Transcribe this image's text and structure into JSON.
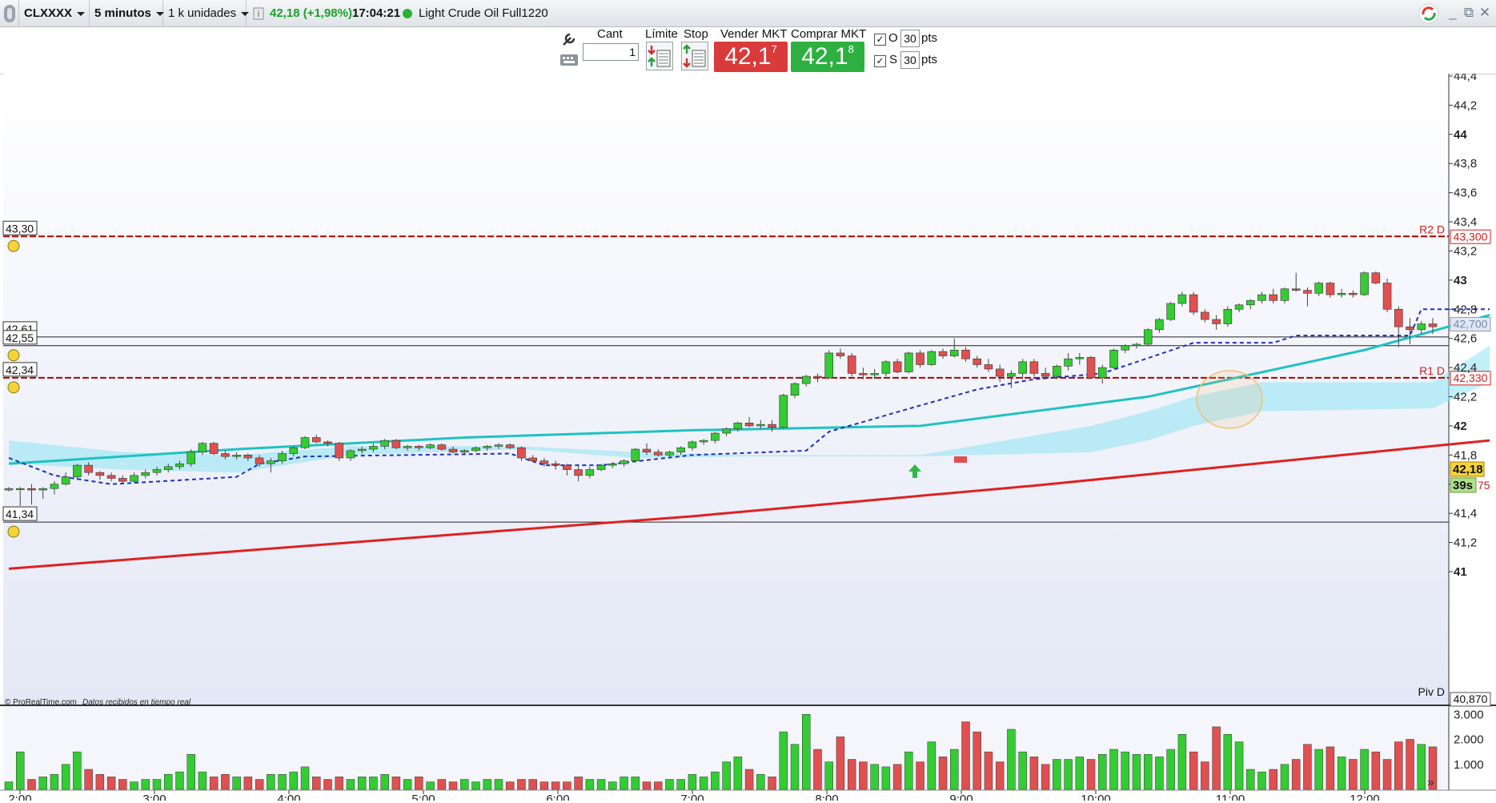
{
  "header": {
    "symbol": "CLXXXX",
    "timeframe": "5 minutos",
    "units": "1 k unidades",
    "info_icon": "info-icon",
    "price_change": "42,18 (+1,98%)",
    "time": "17:04:21",
    "instrument": "Light Crude Oil Full1220"
  },
  "toolbar": {
    "qty_label": "Cant",
    "qty_value": "1",
    "limit_label": "Límite",
    "stop_label": "Stop",
    "sell_label": "Vender MKT",
    "sell_price_main": "42,1",
    "sell_price_sup": "7",
    "buy_label": "Comprar MKT",
    "buy_price_main": "42,1",
    "buy_price_sup": "8",
    "o_label": "O",
    "o_value": "30",
    "s_label": "S",
    "s_value": "30",
    "pts_label": "pts"
  },
  "colors": {
    "up": "#33cc33",
    "down": "#e05050",
    "ema_teal": "#1fc2c2",
    "sma_red": "#e02020",
    "stop_blue": "#1f2fbf",
    "cloud": "#8ee4f2",
    "pivot": "#b00000"
  },
  "footer": {
    "copyright": "© ProRealTime.com",
    "realtime": "Datos recibidos en tiempo real"
  },
  "chart_data": {
    "type": "candlestick",
    "ylim": [
      40.87,
      44.45
    ],
    "y_ticks": [
      "44,4",
      "44,2",
      "44",
      "43,8",
      "43,6",
      "43,4",
      "43,2",
      "43",
      "42,8",
      "42,6",
      "42,4",
      "42,2",
      "42",
      "41,8",
      "41,6",
      "41,4",
      "41,2",
      "41"
    ],
    "x_ticks": [
      "2:00",
      "3:00",
      "4:00",
      "5:00",
      "6:00",
      "7:00",
      "8:00",
      "9:00",
      "10:00",
      "11:00",
      "12:00"
    ],
    "levels": [
      {
        "name": "R2 D",
        "value": 43.3,
        "left_label": "43,30",
        "right_label": "43,300"
      },
      {
        "name": "R1 D",
        "value": 42.33,
        "left_label": "42,34",
        "right_label": "42,330"
      },
      {
        "name": "Piv D",
        "value": 40.87,
        "right_label": "40,870"
      }
    ],
    "hlines": [
      {
        "value": 42.61,
        "left_label": "42,61"
      },
      {
        "value": 42.55,
        "left_label": "42,55"
      },
      {
        "value": 41.34,
        "left_label": "41,34"
      }
    ],
    "right_tags": [
      {
        "label": "42,700"
      },
      {
        "label": "42,18"
      },
      {
        "label": "39s"
      },
      {
        "label": "75"
      }
    ],
    "candles": [
      [
        41.56,
        41.58,
        41.55,
        41.57
      ],
      [
        41.57,
        41.58,
        41.45,
        41.57
      ],
      [
        41.57,
        41.6,
        41.46,
        41.56
      ],
      [
        41.56,
        41.58,
        41.5,
        41.57
      ],
      [
        41.57,
        41.62,
        41.53,
        41.6
      ],
      [
        41.6,
        41.68,
        41.59,
        41.65
      ],
      [
        41.65,
        41.74,
        41.63,
        41.73
      ],
      [
        41.73,
        41.75,
        41.66,
        41.68
      ],
      [
        41.68,
        41.69,
        41.63,
        41.66
      ],
      [
        41.66,
        41.68,
        41.62,
        41.64
      ],
      [
        41.64,
        41.66,
        41.6,
        41.62
      ],
      [
        41.62,
        41.68,
        41.61,
        41.66
      ],
      [
        41.66,
        41.7,
        41.64,
        41.68
      ],
      [
        41.68,
        41.72,
        41.66,
        41.7
      ],
      [
        41.7,
        41.74,
        41.68,
        41.72
      ],
      [
        41.72,
        41.76,
        41.7,
        41.74
      ],
      [
        41.74,
        41.84,
        41.72,
        41.82
      ],
      [
        41.82,
        41.89,
        41.8,
        41.88
      ],
      [
        41.88,
        41.89,
        41.8,
        41.81
      ],
      [
        41.81,
        41.83,
        41.77,
        41.79
      ],
      [
        41.79,
        41.82,
        41.77,
        41.8
      ],
      [
        41.8,
        41.81,
        41.76,
        41.78
      ],
      [
        41.78,
        41.8,
        41.72,
        41.74
      ],
      [
        41.74,
        41.78,
        41.68,
        41.76
      ],
      [
        41.76,
        41.83,
        41.74,
        41.81
      ],
      [
        41.81,
        41.86,
        41.79,
        41.85
      ],
      [
        41.85,
        41.93,
        41.84,
        41.92
      ],
      [
        41.92,
        41.94,
        41.88,
        41.89
      ],
      [
        41.89,
        41.9,
        41.86,
        41.88
      ],
      [
        41.88,
        41.89,
        41.76,
        41.78
      ],
      [
        41.78,
        41.84,
        41.76,
        41.83
      ],
      [
        41.83,
        41.86,
        41.81,
        41.84
      ],
      [
        41.84,
        41.88,
        41.82,
        41.86
      ],
      [
        41.86,
        41.91,
        41.84,
        41.9
      ],
      [
        41.9,
        41.91,
        41.84,
        41.85
      ],
      [
        41.85,
        41.87,
        41.83,
        41.86
      ],
      [
        41.86,
        41.87,
        41.83,
        41.85
      ],
      [
        41.85,
        41.88,
        41.84,
        41.87
      ],
      [
        41.87,
        41.88,
        41.83,
        41.84
      ],
      [
        41.84,
        41.86,
        41.81,
        41.82
      ],
      [
        41.82,
        41.84,
        41.8,
        41.83
      ],
      [
        41.83,
        41.86,
        41.82,
        41.85
      ],
      [
        41.85,
        41.87,
        41.83,
        41.86
      ],
      [
        41.86,
        41.88,
        41.84,
        41.87
      ],
      [
        41.87,
        41.88,
        41.84,
        41.85
      ],
      [
        41.85,
        41.86,
        41.76,
        41.78
      ],
      [
        41.78,
        41.8,
        41.75,
        41.76
      ],
      [
        41.76,
        41.78,
        41.72,
        41.74
      ],
      [
        41.74,
        41.76,
        41.7,
        41.73
      ],
      [
        41.73,
        41.74,
        41.66,
        41.7
      ],
      [
        41.7,
        41.74,
        41.62,
        41.66
      ],
      [
        41.66,
        41.72,
        41.64,
        41.7
      ],
      [
        41.7,
        41.74,
        41.69,
        41.73
      ],
      [
        41.73,
        41.75,
        41.71,
        41.74
      ],
      [
        41.74,
        41.77,
        41.72,
        41.76
      ],
      [
        41.76,
        41.85,
        41.75,
        41.84
      ],
      [
        41.84,
        41.88,
        41.8,
        41.82
      ],
      [
        41.82,
        41.84,
        41.79,
        41.8
      ],
      [
        41.8,
        41.83,
        41.78,
        41.82
      ],
      [
        41.82,
        41.86,
        41.8,
        41.85
      ],
      [
        41.85,
        41.9,
        41.83,
        41.89
      ],
      [
        41.89,
        41.91,
        41.87,
        41.9
      ],
      [
        41.9,
        41.96,
        41.88,
        41.95
      ],
      [
        41.95,
        41.99,
        41.93,
        41.98
      ],
      [
        41.98,
        42.03,
        41.96,
        42.02
      ],
      [
        42.02,
        42.06,
        41.99,
        42.0
      ],
      [
        42.0,
        42.04,
        41.98,
        42.01
      ],
      [
        42.01,
        42.04,
        41.96,
        41.99
      ],
      [
        41.99,
        42.22,
        41.98,
        42.21
      ],
      [
        42.21,
        42.3,
        42.19,
        42.29
      ],
      [
        42.29,
        42.35,
        42.27,
        42.34
      ],
      [
        42.34,
        42.36,
        42.3,
        42.33
      ],
      [
        42.33,
        42.52,
        42.32,
        42.5
      ],
      [
        42.5,
        42.53,
        42.46,
        42.48
      ],
      [
        42.48,
        42.5,
        42.34,
        42.36
      ],
      [
        42.36,
        42.4,
        42.32,
        42.35
      ],
      [
        42.35,
        42.39,
        42.32,
        42.36
      ],
      [
        42.36,
        42.45,
        42.34,
        42.44
      ],
      [
        42.44,
        42.46,
        42.36,
        42.37
      ],
      [
        42.37,
        42.51,
        42.36,
        42.5
      ],
      [
        42.5,
        42.52,
        42.4,
        42.42
      ],
      [
        42.42,
        42.52,
        42.41,
        42.51
      ],
      [
        42.51,
        42.53,
        42.46,
        42.48
      ],
      [
        42.48,
        42.6,
        42.47,
        42.52
      ],
      [
        42.52,
        42.54,
        42.44,
        42.46
      ],
      [
        42.46,
        42.48,
        42.4,
        42.42
      ],
      [
        42.42,
        42.46,
        42.37,
        42.39
      ],
      [
        42.39,
        42.42,
        42.3,
        42.34
      ],
      [
        42.34,
        42.38,
        42.26,
        42.36
      ],
      [
        42.36,
        42.46,
        42.32,
        42.44
      ],
      [
        42.44,
        42.46,
        42.34,
        42.36
      ],
      [
        42.36,
        42.4,
        42.32,
        42.34
      ],
      [
        42.34,
        42.42,
        42.32,
        42.41
      ],
      [
        42.41,
        42.5,
        42.38,
        42.46
      ],
      [
        42.46,
        42.5,
        42.42,
        42.47
      ],
      [
        42.47,
        42.48,
        42.32,
        42.33
      ],
      [
        42.33,
        42.42,
        42.29,
        42.4
      ],
      [
        42.4,
        42.53,
        42.39,
        42.52
      ],
      [
        42.52,
        42.56,
        42.5,
        42.55
      ],
      [
        42.55,
        42.57,
        42.53,
        42.56
      ],
      [
        42.56,
        42.67,
        42.55,
        42.66
      ],
      [
        42.66,
        42.74,
        42.64,
        42.73
      ],
      [
        42.73,
        42.85,
        42.72,
        42.84
      ],
      [
        42.84,
        42.92,
        42.82,
        42.9
      ],
      [
        42.9,
        42.92,
        42.76,
        42.78
      ],
      [
        42.78,
        42.8,
        42.71,
        42.73
      ],
      [
        42.73,
        42.76,
        42.66,
        42.7
      ],
      [
        42.7,
        42.82,
        42.68,
        42.8
      ],
      [
        42.8,
        42.84,
        42.78,
        42.83
      ],
      [
        42.83,
        42.87,
        42.8,
        42.86
      ],
      [
        42.86,
        42.92,
        42.84,
        42.9
      ],
      [
        42.9,
        42.94,
        42.84,
        42.86
      ],
      [
        42.86,
        42.95,
        42.84,
        42.94
      ],
      [
        42.94,
        43.05,
        42.92,
        42.93
      ],
      [
        42.93,
        42.95,
        42.82,
        42.91
      ],
      [
        42.91,
        42.99,
        42.89,
        42.98
      ],
      [
        42.98,
        42.99,
        42.88,
        42.9
      ],
      [
        42.9,
        42.94,
        42.88,
        42.91
      ],
      [
        42.91,
        42.93,
        42.88,
        42.9
      ],
      [
        42.9,
        43.06,
        42.89,
        43.05
      ],
      [
        43.05,
        43.06,
        42.97,
        42.98
      ],
      [
        42.98,
        43.01,
        42.78,
        42.8
      ],
      [
        42.8,
        42.82,
        42.54,
        42.68
      ],
      [
        42.68,
        42.74,
        42.56,
        42.66
      ],
      [
        42.66,
        42.72,
        42.63,
        42.7
      ],
      [
        42.7,
        42.74,
        42.63,
        42.68
      ]
    ],
    "volume": {
      "ylim": [
        0,
        3200
      ],
      "y_ticks": [
        "3.000",
        "2.000",
        "1.000"
      ],
      "values": [
        300,
        1500,
        400,
        500,
        600,
        1000,
        1500,
        800,
        600,
        500,
        400,
        300,
        400,
        400,
        600,
        700,
        1400,
        700,
        500,
        600,
        500,
        500,
        400,
        600,
        600,
        700,
        900,
        500,
        400,
        500,
        400,
        500,
        500,
        600,
        500,
        400,
        500,
        300,
        400,
        300,
        400,
        300,
        400,
        400,
        300,
        400,
        400,
        300,
        300,
        300,
        500,
        400,
        400,
        300,
        500,
        500,
        300,
        300,
        400,
        400,
        600,
        500,
        700,
        1100,
        1300,
        800,
        600,
        500,
        2300,
        1800,
        3000,
        1600,
        1100,
        2100,
        1200,
        1100,
        1000,
        900,
        1000,
        1500,
        1100,
        1900,
        1300,
        1600,
        2700,
        2300,
        1500,
        1100,
        2400,
        1500,
        1300,
        1000,
        1200,
        1200,
        1300,
        1200,
        1400,
        1600,
        1500,
        1400,
        1400,
        1300,
        1600,
        2200,
        1500,
        1100,
        2500,
        2200,
        1900,
        800,
        700,
        800,
        1000,
        1200,
        1800,
        1600,
        1700,
        1300,
        1200,
        1600,
        1500,
        1200,
        1900,
        2000,
        1800,
        1700
      ]
    },
    "series": [
      {
        "name": "ema_teal",
        "x": [
          0,
          20,
          40,
          60,
          80,
          100,
          119,
          130
        ],
        "values": [
          41.74,
          41.84,
          41.92,
          41.97,
          42.0,
          42.2,
          42.52,
          42.76
        ]
      },
      {
        "name": "sma_red",
        "x": [
          0,
          30,
          60,
          90,
          130
        ],
        "values": [
          41.02,
          41.2,
          41.38,
          41.59,
          41.9
        ]
      },
      {
        "name": "trailing_stop",
        "x": [
          0,
          4,
          9,
          20,
          22,
          26,
          44,
          47,
          52,
          60,
          70,
          72,
          80,
          85,
          90,
          96,
          104,
          106,
          111,
          113,
          123,
          124,
          125,
          130
        ],
        "values": [
          41.78,
          41.66,
          41.6,
          41.65,
          41.74,
          41.79,
          41.81,
          41.73,
          41.73,
          41.8,
          41.83,
          41.96,
          42.14,
          42.25,
          42.32,
          42.36,
          42.57,
          42.57,
          42.57,
          42.62,
          42.62,
          42.8,
          42.8,
          42.8
        ]
      },
      {
        "name": "cloud_top",
        "x": [
          0,
          10,
          20,
          30,
          45,
          55,
          65,
          80,
          95,
          100,
          104,
          110,
          125,
          130
        ],
        "values": [
          41.9,
          41.82,
          41.8,
          41.86,
          41.86,
          41.82,
          41.8,
          41.8,
          42.0,
          42.1,
          42.2,
          42.3,
          42.3,
          42.55
        ]
      },
      {
        "name": "cloud_bottom",
        "x": [
          0,
          10,
          20,
          30,
          45,
          55,
          65,
          80,
          95,
          100,
          104,
          110,
          125,
          130
        ],
        "values": [
          41.74,
          41.7,
          41.68,
          41.8,
          41.84,
          41.78,
          41.79,
          41.79,
          41.82,
          41.9,
          42.0,
          42.1,
          42.12,
          42.3
        ]
      }
    ]
  }
}
